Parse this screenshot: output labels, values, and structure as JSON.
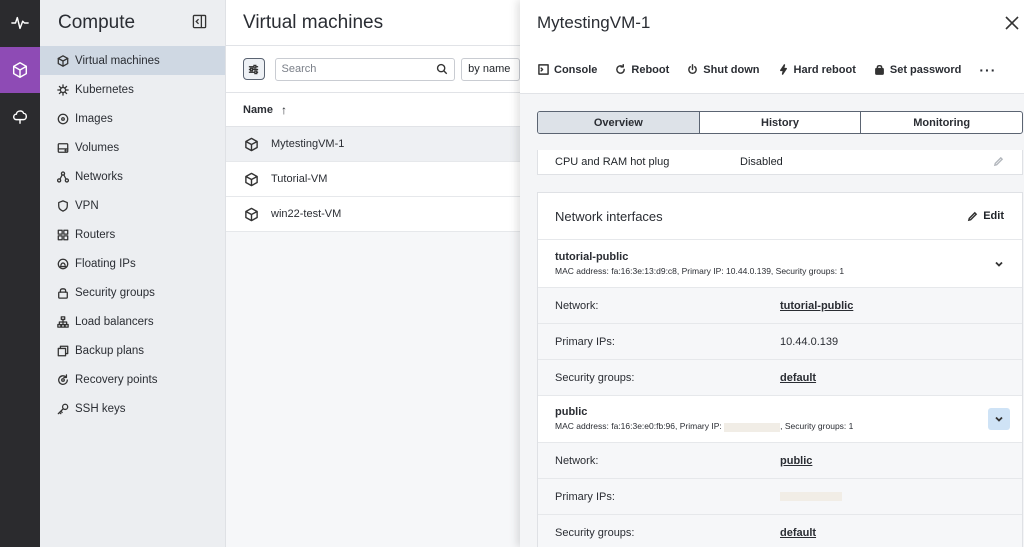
{
  "rail": {
    "items": [
      {
        "icon": "activity-icon",
        "active": false
      },
      {
        "icon": "cube-icon",
        "active": true
      },
      {
        "icon": "cloud-icon",
        "active": false
      }
    ]
  },
  "sidebar": {
    "title": "Compute",
    "items": [
      {
        "label": "Virtual machines",
        "icon": "cube-icon"
      },
      {
        "label": "Kubernetes",
        "icon": "kubernetes-icon"
      },
      {
        "label": "Images",
        "icon": "disc-icon"
      },
      {
        "label": "Volumes",
        "icon": "volume-icon"
      },
      {
        "label": "Networks",
        "icon": "network-icon"
      },
      {
        "label": "VPN",
        "icon": "shield-icon"
      },
      {
        "label": "Routers",
        "icon": "router-icon"
      },
      {
        "label": "Floating IPs",
        "icon": "floating-ip-icon"
      },
      {
        "label": "Security groups",
        "icon": "lock-icon"
      },
      {
        "label": "Load balancers",
        "icon": "load-balancer-icon"
      },
      {
        "label": "Backup plans",
        "icon": "backup-icon"
      },
      {
        "label": "Recovery points",
        "icon": "recovery-icon"
      },
      {
        "label": "SSH keys",
        "icon": "key-icon"
      }
    ]
  },
  "list": {
    "title": "Virtual machines",
    "search_placeholder": "Search",
    "sort_label": "by name",
    "column_name": "Name",
    "sort_arrow": "↑",
    "rows": [
      {
        "name": "MytestingVM-1"
      },
      {
        "name": "Tutorial-VM"
      },
      {
        "name": "win22-test-VM"
      }
    ]
  },
  "detail": {
    "title": "MytestingVM-1",
    "actions": {
      "console": "Console",
      "reboot": "Reboot",
      "shutdown": "Shut down",
      "hard_reboot": "Hard reboot",
      "set_password": "Set password",
      "more": "···"
    },
    "tabs": [
      "Overview",
      "History",
      "Monitoring"
    ],
    "hotplug": {
      "label": "CPU and RAM hot plug",
      "value": "Disabled"
    },
    "network_card": {
      "title": "Network interfaces",
      "edit_label": "Edit",
      "interfaces": [
        {
          "name": "tutorial-public",
          "mac_line": "MAC address: fa:16:3e:13:d9:c8, Primary IP: 10.44.0.139, Security groups: 1",
          "network_label": "Network:",
          "network_value": "tutorial-public",
          "ips_label": "Primary IPs:",
          "ips_value": "10.44.0.139",
          "sg_label": "Security groups:",
          "sg_value": "default"
        },
        {
          "name": "public",
          "mac_prefix": "MAC address: fa:16:3e:e0:fb:96, Primary IP: ",
          "mac_suffix": ", Security groups: 1",
          "network_label": "Network:",
          "network_value": "public",
          "ips_label": "Primary IPs:",
          "sg_label": "Security groups:",
          "sg_value": "default"
        }
      ]
    }
  }
}
